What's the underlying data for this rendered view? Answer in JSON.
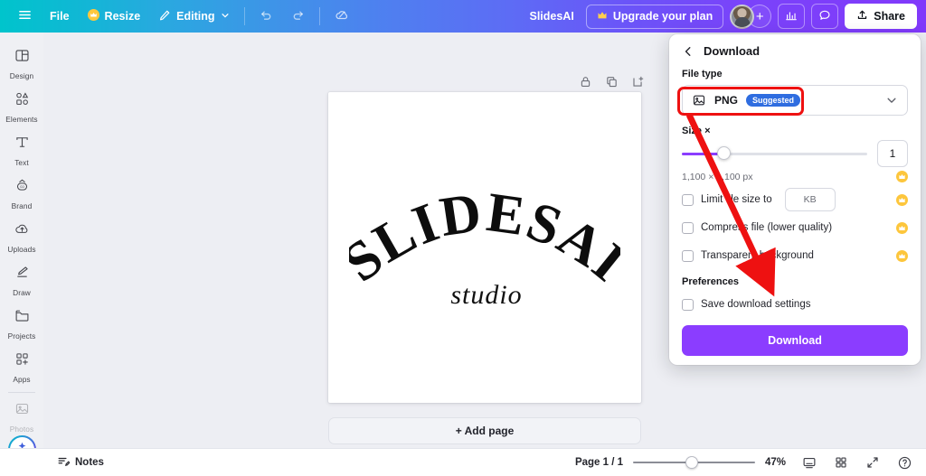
{
  "topbar": {
    "menu_icon": "hamburger-icon",
    "file_label": "File",
    "resize_label": "Resize",
    "resize_icon": "crown-icon",
    "editing_label": "Editing",
    "editing_icon": "pencil-icon",
    "undo_icon": "undo-icon",
    "redo_icon": "redo-icon",
    "cloud_icon": "cloud-sync-icon",
    "doc_title": "SlidesAI",
    "upgrade_label": "Upgrade your plan",
    "upgrade_icon": "crown-icon",
    "avatar": "user-avatar",
    "plus_label": "+",
    "insights_icon": "bar-chart-icon",
    "comment_icon": "comment-bubble-icon",
    "share_label": "Share",
    "share_icon": "upload-icon"
  },
  "sidebar": {
    "items": [
      {
        "label": "Design",
        "icon": "layout-panels-icon"
      },
      {
        "label": "Elements",
        "icon": "shapes-icon"
      },
      {
        "label": "Text",
        "icon": "text-t-icon"
      },
      {
        "label": "Brand",
        "icon": "brand-stamp-icon"
      },
      {
        "label": "Uploads",
        "icon": "cloud-upload-icon"
      },
      {
        "label": "Draw",
        "icon": "pen-icon"
      },
      {
        "label": "Projects",
        "icon": "folder-icon"
      },
      {
        "label": "Apps",
        "icon": "apps-grid-icon"
      },
      {
        "label": "Photos",
        "icon": "photo-icon"
      }
    ],
    "magic_button": "magic-sparkle-icon"
  },
  "canvas": {
    "tools": [
      {
        "name": "lock-icon"
      },
      {
        "name": "duplicate-page-icon"
      },
      {
        "name": "add-page-icon"
      }
    ],
    "logo_title": "SLIDESAI",
    "logo_subtitle": "studio",
    "add_page_label": "+ Add page"
  },
  "bottombar": {
    "notes_label": "Notes",
    "notes_icon": "notes-icon",
    "page_count": "Page 1 / 1",
    "zoom_value": "47%",
    "present_icon": "present-icon",
    "grid_icon": "grid-view-icon",
    "fullscreen_icon": "expand-icon",
    "help_icon": "help-circle-icon"
  },
  "download_panel": {
    "back_icon": "chevron-left-icon",
    "title": "Download",
    "file_type_label": "File type",
    "file_type_icon": "image-file-icon",
    "file_type_value": "PNG",
    "file_type_badge": "Suggested",
    "caret_icon": "chevron-down-icon",
    "size_label": "Size ×",
    "size_value": "1",
    "size_px": "1,100 × 1,100 px",
    "options": [
      {
        "label": "Limit file size to",
        "checked": false,
        "pro": true,
        "field": "KB"
      },
      {
        "label": "Compress file (lower quality)",
        "checked": false,
        "pro": true
      },
      {
        "label": "Transparent background",
        "checked": false,
        "pro": true
      }
    ],
    "preferences_label": "Preferences",
    "save_settings_label": "Save download settings",
    "save_settings_checked": false,
    "download_button": "Download",
    "accent_color": "#8b3dff",
    "badge_color": "#2f6de0",
    "pro_color": "#fdc63c",
    "annotation_color": "#ee1111"
  }
}
